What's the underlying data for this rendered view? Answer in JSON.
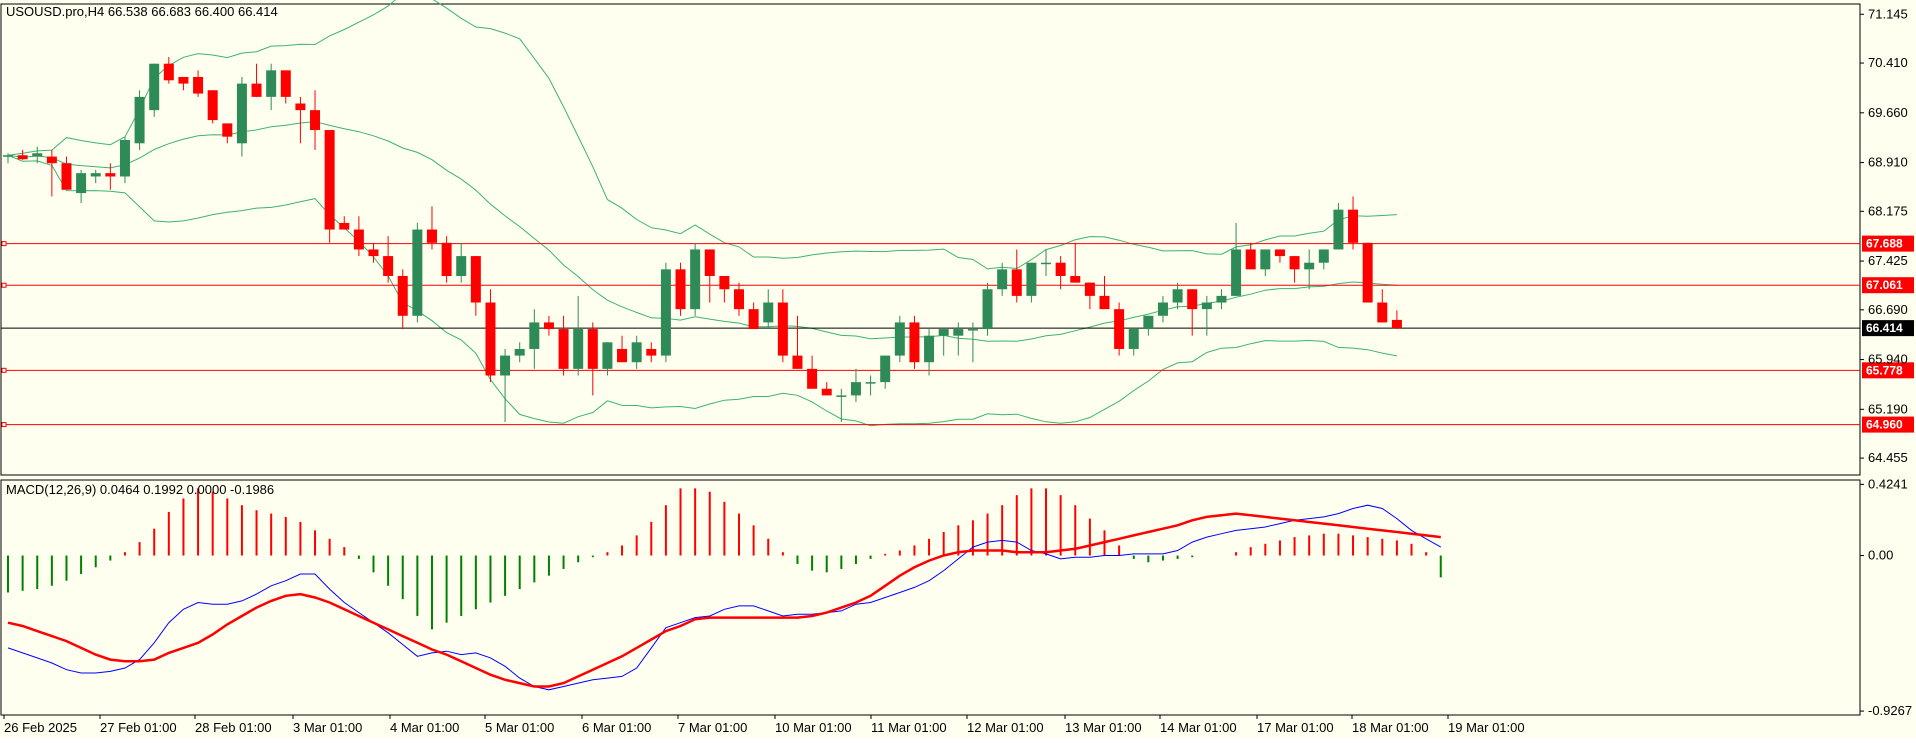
{
  "header": {
    "symbol_info": "USOUSD.pro,H4  66.538 66.683 66.400 66.414",
    "macd_info": "MACD(12,26,9) 0.0464 0.1992 0.0000 -0.1986"
  },
  "colors": {
    "background": "#fffff0",
    "bull_candle": "#2e8b57",
    "bear_candle": "#ff0000",
    "bollinger": "#3cb371",
    "level_line": "#ff0000",
    "current_price_line": "#000000",
    "macd_hist_up": "#ff0000",
    "macd_hist_down": "#008000",
    "macd_line": "#0000ff",
    "signal_line": "#ff0000"
  },
  "chart_data": [
    {
      "type": "candlestick",
      "title": "USOUSD.pro,H4",
      "y_ticks": [
        "71.145",
        "70.410",
        "69.660",
        "68.910",
        "68.175",
        "67.425",
        "66.690",
        "65.940",
        "65.190",
        "64.455"
      ],
      "ylim": [
        64.2,
        71.3
      ],
      "x_ticks": [
        "26 Feb 2025",
        "27 Feb 01:00",
        "28 Feb 01:00",
        "3 Mar 01:00",
        "4 Mar 01:00",
        "5 Mar 01:00",
        "6 Mar 01:00",
        "7 Mar 01:00",
        "10 Mar 01:00",
        "11 Mar 01:00",
        "12 Mar 01:00",
        "13 Mar 01:00",
        "14 Mar 01:00",
        "17 Mar 01:00",
        "18 Mar 01:00",
        "19 Mar 01:00"
      ],
      "horizontal_levels": [
        "67.688",
        "67.061",
        "65.778",
        "64.960"
      ],
      "current_price": "66.414",
      "candles": [
        [
          69.0,
          69.05,
          68.9,
          69.02
        ],
        [
          69.02,
          69.1,
          68.95,
          68.96
        ],
        [
          69.0,
          69.15,
          68.9,
          69.05
        ],
        [
          69.0,
          69.1,
          68.4,
          68.9
        ],
        [
          68.9,
          69.0,
          68.6,
          68.5
        ],
        [
          68.45,
          68.8,
          68.3,
          68.75
        ],
        [
          68.7,
          68.8,
          68.6,
          68.75
        ],
        [
          68.75,
          68.9,
          68.5,
          68.7
        ],
        [
          68.7,
          69.3,
          68.6,
          69.25
        ],
        [
          69.2,
          70.0,
          69.1,
          69.9
        ],
        [
          69.7,
          70.4,
          69.6,
          70.4
        ],
        [
          70.4,
          70.5,
          70.1,
          70.15
        ],
        [
          70.2,
          70.2,
          70.0,
          70.1
        ],
        [
          70.2,
          70.3,
          69.9,
          69.95
        ],
        [
          70.0,
          70.0,
          69.5,
          69.55
        ],
        [
          69.5,
          69.5,
          69.2,
          69.3
        ],
        [
          69.2,
          70.2,
          69.0,
          70.1
        ],
        [
          70.1,
          70.4,
          69.9,
          69.9
        ],
        [
          69.9,
          70.4,
          69.7,
          70.3
        ],
        [
          70.3,
          70.3,
          69.8,
          69.9
        ],
        [
          69.8,
          69.9,
          69.2,
          69.7
        ],
        [
          69.7,
          70.0,
          69.1,
          69.4
        ],
        [
          69.4,
          69.4,
          67.7,
          67.9
        ],
        [
          68.0,
          68.1,
          67.9,
          67.9
        ],
        [
          67.9,
          68.1,
          67.5,
          67.6
        ],
        [
          67.6,
          67.7,
          67.4,
          67.5
        ],
        [
          67.5,
          67.8,
          67.1,
          67.2
        ],
        [
          67.2,
          67.3,
          66.4,
          66.6
        ],
        [
          66.6,
          68.0,
          66.5,
          67.9
        ],
        [
          67.9,
          68.25,
          67.6,
          67.7
        ],
        [
          67.7,
          67.8,
          67.1,
          67.2
        ],
        [
          67.2,
          67.7,
          67.1,
          67.5
        ],
        [
          67.5,
          67.5,
          66.6,
          66.8
        ],
        [
          66.8,
          67.0,
          65.6,
          65.7
        ],
        [
          65.7,
          66.1,
          65.0,
          66.0
        ],
        [
          66.0,
          66.2,
          65.9,
          66.1
        ],
        [
          66.1,
          66.7,
          65.8,
          66.5
        ],
        [
          66.5,
          66.6,
          66.3,
          66.4
        ],
        [
          66.4,
          66.6,
          65.7,
          65.8
        ],
        [
          65.8,
          66.9,
          65.7,
          66.4
        ],
        [
          66.4,
          66.5,
          65.4,
          65.8
        ],
        [
          65.8,
          66.2,
          65.7,
          66.2
        ],
        [
          66.1,
          66.3,
          65.9,
          65.9
        ],
        [
          65.9,
          66.3,
          65.8,
          66.2
        ],
        [
          66.1,
          66.2,
          65.9,
          66.0
        ],
        [
          66.0,
          67.4,
          65.9,
          67.3
        ],
        [
          67.3,
          67.4,
          66.6,
          66.7
        ],
        [
          66.7,
          67.7,
          66.6,
          67.6
        ],
        [
          67.6,
          67.6,
          66.8,
          67.2
        ],
        [
          67.2,
          67.2,
          66.8,
          67.0
        ],
        [
          67.0,
          67.1,
          66.6,
          66.7
        ],
        [
          66.7,
          66.8,
          66.5,
          66.4
        ],
        [
          66.5,
          67.0,
          66.4,
          66.8
        ],
        [
          66.8,
          67.0,
          65.9,
          66.0
        ],
        [
          66.0,
          66.6,
          65.9,
          65.8
        ],
        [
          65.8,
          66.0,
          65.7,
          65.5
        ],
        [
          65.5,
          65.6,
          65.4,
          65.4
        ],
        [
          65.4,
          65.5,
          65.0,
          65.4
        ],
        [
          65.4,
          65.8,
          65.3,
          65.6
        ],
        [
          65.6,
          65.7,
          65.4,
          65.6
        ],
        [
          65.6,
          66.0,
          65.5,
          66.0
        ],
        [
          66.0,
          66.6,
          65.9,
          66.5
        ],
        [
          66.5,
          66.6,
          65.8,
          65.9
        ],
        [
          65.9,
          66.4,
          65.7,
          66.3
        ],
        [
          66.3,
          66.4,
          66.0,
          66.4
        ],
        [
          66.3,
          66.5,
          66.0,
          66.4
        ],
        [
          66.4,
          66.5,
          65.9,
          66.4
        ],
        [
          66.4,
          67.1,
          66.3,
          67.0
        ],
        [
          67.0,
          67.4,
          66.9,
          67.3
        ],
        [
          67.3,
          67.6,
          66.8,
          66.9
        ],
        [
          66.9,
          67.4,
          66.8,
          67.4
        ],
        [
          67.4,
          67.6,
          67.2,
          67.4
        ],
        [
          67.4,
          67.5,
          67.0,
          67.2
        ],
        [
          67.2,
          67.7,
          67.1,
          67.1
        ],
        [
          67.1,
          67.1,
          66.7,
          66.9
        ],
        [
          66.9,
          67.2,
          66.8,
          66.7
        ],
        [
          66.7,
          66.8,
          66.0,
          66.1
        ],
        [
          66.1,
          66.4,
          66.0,
          66.4
        ],
        [
          66.4,
          66.6,
          66.3,
          66.6
        ],
        [
          66.6,
          66.9,
          66.5,
          66.8
        ],
        [
          66.8,
          67.1,
          66.7,
          67.0
        ],
        [
          67.0,
          67.0,
          66.3,
          66.7
        ],
        [
          66.7,
          66.9,
          66.3,
          66.8
        ],
        [
          66.8,
          67.0,
          66.7,
          66.9
        ],
        [
          66.9,
          68.0,
          66.9,
          67.6
        ],
        [
          67.6,
          67.7,
          67.3,
          67.3
        ],
        [
          67.3,
          67.6,
          67.2,
          67.6
        ],
        [
          67.6,
          67.6,
          67.4,
          67.5
        ],
        [
          67.5,
          67.5,
          67.1,
          67.3
        ],
        [
          67.3,
          67.6,
          67.0,
          67.4
        ],
        [
          67.4,
          67.6,
          67.3,
          67.6
        ],
        [
          67.6,
          68.3,
          67.6,
          68.2
        ],
        [
          68.2,
          68.4,
          67.6,
          67.7
        ],
        [
          67.7,
          67.7,
          66.8,
          66.8
        ],
        [
          66.8,
          67.0,
          66.5,
          66.5
        ],
        [
          66.538,
          66.683,
          66.4,
          66.414
        ]
      ]
    },
    {
      "type": "macd",
      "title": "MACD(12,26,9)",
      "y_ticks": [
        "0.4241",
        "0.00",
        "-0.9267"
      ],
      "ylim": [
        -0.95,
        0.45
      ],
      "histogram": [
        -0.22,
        -0.21,
        -0.2,
        -0.18,
        -0.15,
        -0.11,
        -0.07,
        -0.03,
        0.02,
        0.08,
        0.16,
        0.26,
        0.34,
        0.4,
        0.38,
        0.34,
        0.3,
        0.27,
        0.25,
        0.23,
        0.2,
        0.15,
        0.1,
        0.05,
        -0.02,
        -0.1,
        -0.18,
        -0.26,
        -0.36,
        -0.44,
        -0.4,
        -0.36,
        -0.32,
        -0.28,
        -0.24,
        -0.2,
        -0.16,
        -0.12,
        -0.08,
        -0.04,
        -0.01,
        0.02,
        0.06,
        0.12,
        0.2,
        0.3,
        0.4,
        0.4,
        0.38,
        0.32,
        0.25,
        0.18,
        0.1,
        0.02,
        -0.05,
        -0.09,
        -0.1,
        -0.08,
        -0.05,
        -0.02,
        0.01,
        0.03,
        0.06,
        0.1,
        0.14,
        0.18,
        0.21,
        0.25,
        0.3,
        0.36,
        0.4,
        0.4,
        0.36,
        0.3,
        0.22,
        0.15,
        0.06,
        -0.02,
        -0.04,
        -0.03,
        -0.02,
        -0.01,
        0.0,
        0.0,
        0.02,
        0.05,
        0.07,
        0.09,
        0.11,
        0.12,
        0.13,
        0.13,
        0.12,
        0.11,
        0.1,
        0.09,
        0.07,
        0.02,
        -0.13
      ],
      "macd_line": [
        -0.55,
        -0.58,
        -0.61,
        -0.64,
        -0.68,
        -0.7,
        -0.7,
        -0.69,
        -0.67,
        -0.62,
        -0.52,
        -0.4,
        -0.32,
        -0.28,
        -0.29,
        -0.29,
        -0.27,
        -0.23,
        -0.18,
        -0.15,
        -0.11,
        -0.11,
        -0.2,
        -0.28,
        -0.34,
        -0.4,
        -0.46,
        -0.53,
        -0.6,
        -0.58,
        -0.57,
        -0.59,
        -0.58,
        -0.61,
        -0.66,
        -0.73,
        -0.78,
        -0.8,
        -0.78,
        -0.76,
        -0.74,
        -0.73,
        -0.72,
        -0.67,
        -0.55,
        -0.43,
        -0.4,
        -0.37,
        -0.36,
        -0.32,
        -0.3,
        -0.3,
        -0.33,
        -0.36,
        -0.35,
        -0.35,
        -0.34,
        -0.33,
        -0.29,
        -0.28,
        -0.25,
        -0.22,
        -0.19,
        -0.15,
        -0.09,
        -0.02,
        0.05,
        0.08,
        0.09,
        0.08,
        0.03,
        0.01,
        -0.02,
        -0.01,
        -0.01,
        0.0,
        0.0,
        0.01,
        0.01,
        0.01,
        0.03,
        0.08,
        0.11,
        0.13,
        0.15,
        0.16,
        0.17,
        0.19,
        0.21,
        0.22,
        0.23,
        0.25,
        0.28,
        0.3,
        0.28,
        0.22,
        0.15,
        0.1,
        0.05
      ],
      "signal_line": [
        -0.4,
        -0.42,
        -0.45,
        -0.48,
        -0.51,
        -0.55,
        -0.59,
        -0.62,
        -0.63,
        -0.63,
        -0.62,
        -0.58,
        -0.55,
        -0.52,
        -0.47,
        -0.41,
        -0.36,
        -0.31,
        -0.27,
        -0.24,
        -0.23,
        -0.25,
        -0.28,
        -0.32,
        -0.36,
        -0.4,
        -0.44,
        -0.48,
        -0.52,
        -0.56,
        -0.59,
        -0.63,
        -0.67,
        -0.71,
        -0.74,
        -0.76,
        -0.78,
        -0.78,
        -0.76,
        -0.72,
        -0.68,
        -0.64,
        -0.6,
        -0.55,
        -0.5,
        -0.45,
        -0.42,
        -0.38,
        -0.37,
        -0.37,
        -0.37,
        -0.37,
        -0.37,
        -0.37,
        -0.37,
        -0.36,
        -0.34,
        -0.31,
        -0.28,
        -0.24,
        -0.18,
        -0.12,
        -0.07,
        -0.03,
        0.0,
        0.02,
        0.03,
        0.03,
        0.03,
        0.02,
        0.02,
        0.02,
        0.03,
        0.04,
        0.06,
        0.08,
        0.1,
        0.12,
        0.14,
        0.16,
        0.18,
        0.21,
        0.23,
        0.24,
        0.25,
        0.24,
        0.23,
        0.22,
        0.21,
        0.2,
        0.19,
        0.18,
        0.17,
        0.16,
        0.15,
        0.14,
        0.13,
        0.12,
        0.11
      ]
    }
  ]
}
